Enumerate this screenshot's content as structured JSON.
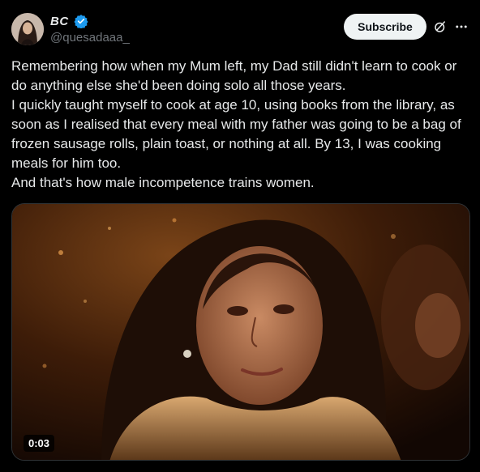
{
  "author": {
    "display_name": "BC",
    "handle": "@quesadaaa_",
    "verified": true,
    "avatar_icon": "profile-photo"
  },
  "actions": {
    "subscribe_label": "Subscribe",
    "grok_icon": "grok-icon",
    "more_icon": "more-horizontal-icon"
  },
  "tweet": {
    "paragraphs": [
      "Remembering how when my Mum left, my Dad still didn't learn to cook or do anything else she'd been doing solo all those years.",
      "I quickly taught myself to cook at age 10, using books from the library, as soon as I realised that every meal with my father was going to be a bag of frozen sausage rolls, plain toast, or nothing at all. By 13, I was cooking meals for him too.",
      "And that's how male incompetence trains women."
    ]
  },
  "media": {
    "type": "video",
    "duration": "0:03"
  },
  "colors": {
    "background": "#000000",
    "text": "#e7e9ea",
    "secondary_text": "#71767b",
    "verified_blue": "#1d9bf0",
    "button_bg": "#eff3f4"
  }
}
